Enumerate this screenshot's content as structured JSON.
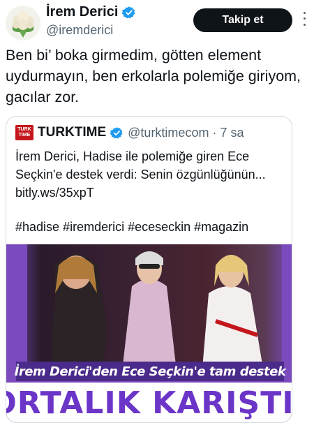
{
  "author": {
    "display_name": "İrem Derici",
    "handle": "@iremderici",
    "avatar_icon": "cauliflower-avatar",
    "verified_icon": "verified-badge-icon"
  },
  "actions": {
    "follow_label": "Takip et",
    "more_icon": "more-options-icon"
  },
  "tweet": {
    "text": "Ben bi’ boka girmedim, götten element uydurmayın, ben erkolarla polemiğe giriyom, gacılar zor."
  },
  "quote": {
    "logo_line1": "TURK",
    "logo_line2": "TIME",
    "name": "TURKTIME",
    "handle_time": "@turktimecom · 7 sa",
    "text": "İrem Derici, Hadise ile polemiğe giren Ece Seçkin'e destek verdi: Senin özgünlüğünün...",
    "link": "bitly.ws/35xpT",
    "hashtags": "#hadise #iremderici #eceseckin #magazin",
    "media": {
      "caption": "İrem Derici'den Ece Seçkin'e tam destek",
      "headline": "ORTALIK KARIŞTI!"
    }
  },
  "colors": {
    "accent": "#1d9bf0",
    "follow_bg": "#0f1419",
    "media_purple": "#6b35c8",
    "brand_red": "#c4161c"
  }
}
